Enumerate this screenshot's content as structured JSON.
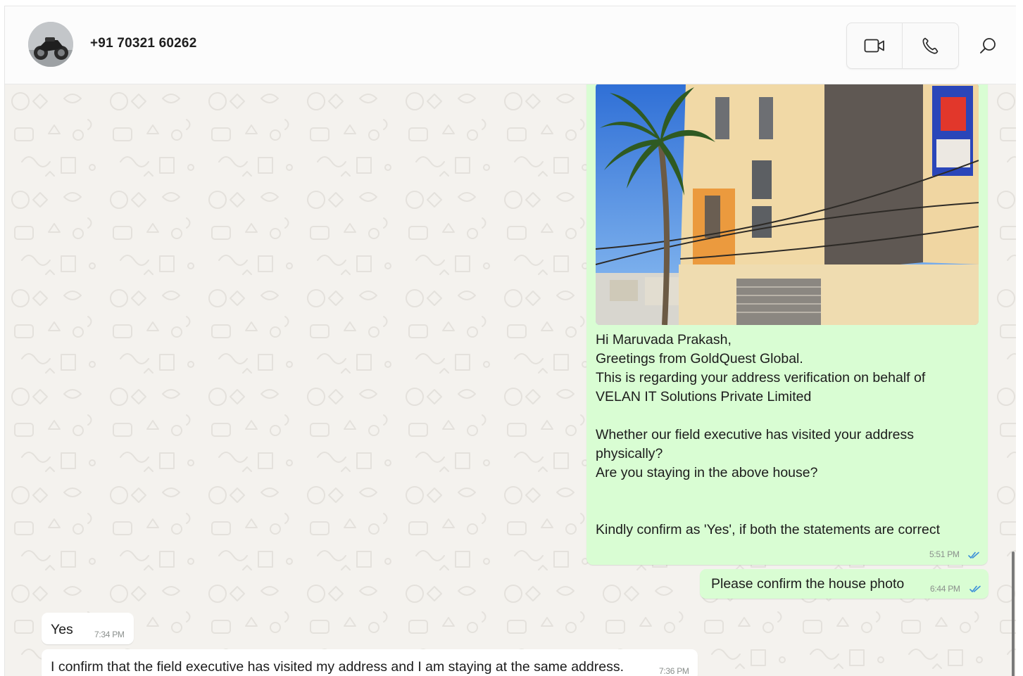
{
  "header": {
    "contact_name": "+91 70321 60262",
    "video_call_icon": "video-camera-icon",
    "voice_call_icon": "phone-icon",
    "search_icon": "search-icon"
  },
  "colors": {
    "outgoing_bubble": "#d9fdd3",
    "incoming_bubble": "#ffffff",
    "read_tick": "#3b8fd9",
    "chat_background": "#f4f2ee"
  },
  "messages": [
    {
      "direction": "outgoing",
      "type": "image_with_caption",
      "text": "Hi Maruvada Prakash,\nGreetings from GoldQuest Global.\nThis is regarding your address verification on behalf of\nVELAN IT Solutions Private Limited\n\nWhether our field executive has visited your address\nphysically?\nAre you staying in the above house?\n\n\nKindly confirm as 'Yes', if both the statements are correct",
      "time": "5:51 PM",
      "status": "read"
    },
    {
      "direction": "outgoing",
      "type": "text",
      "text": "Please confirm the house photo",
      "time": "6:44 PM",
      "status": "read"
    },
    {
      "direction": "incoming",
      "type": "text",
      "text": "Yes",
      "time": "7:34 PM"
    },
    {
      "direction": "incoming",
      "type": "text",
      "text": "I confirm that the field executive has visited my address and I am staying at the same address.",
      "time": "7:36 PM"
    }
  ]
}
